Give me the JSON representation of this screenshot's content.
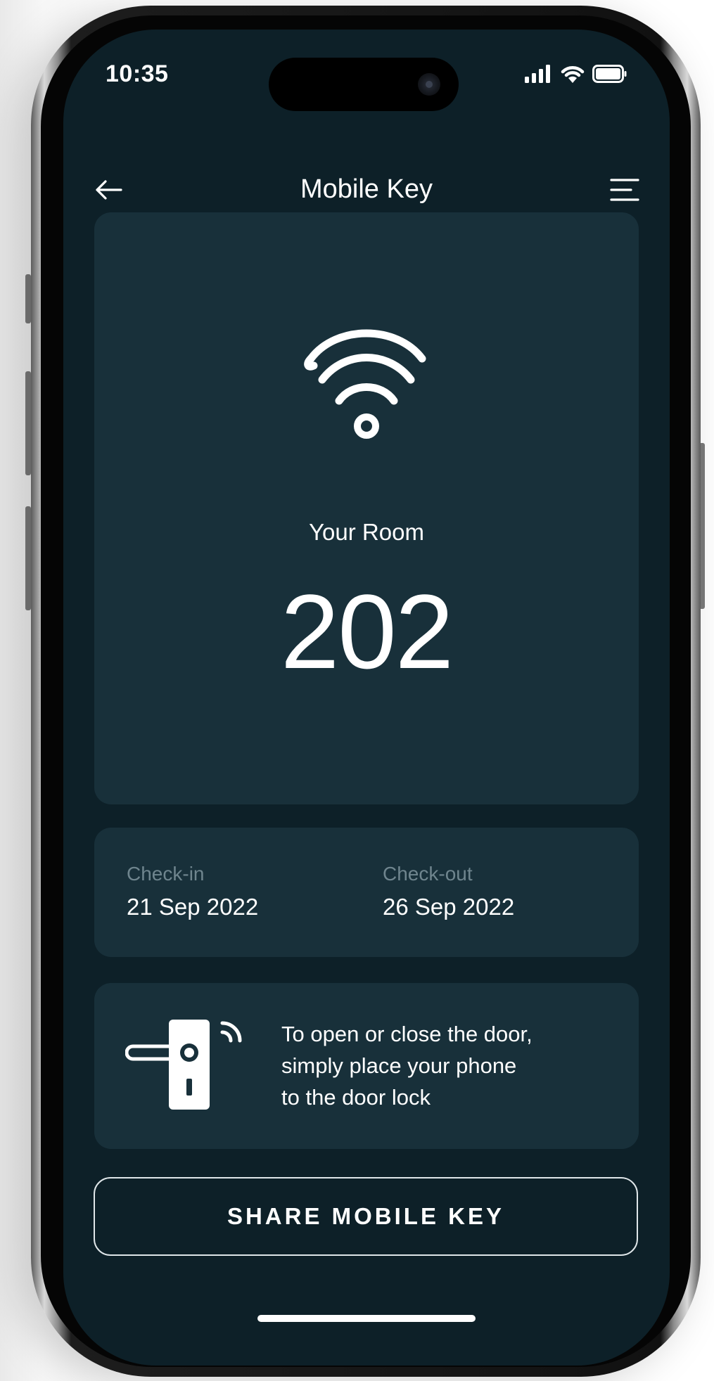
{
  "status_bar": {
    "time": "10:35",
    "icons": [
      "signal-icon",
      "wifi-icon",
      "battery-icon"
    ]
  },
  "header": {
    "title": "Mobile Key",
    "back_icon": "arrow-left-icon",
    "menu_icon": "menu-icon"
  },
  "room": {
    "icon": "wireless-signal-icon",
    "label": "Your Room",
    "number": "202"
  },
  "stay": {
    "checkin_label": "Check-in",
    "checkin_date": "21 Sep 2022",
    "checkout_label": "Check-out",
    "checkout_date": "26 Sep 2022"
  },
  "instructions": {
    "icon": "door-lock-icon",
    "text": "To open or close the door,\nsimply place your phone\nto the door lock"
  },
  "actions": {
    "share_label": "SHARE MOBILE KEY"
  },
  "colors": {
    "screen_bg": "#0d2028",
    "card_bg": "#18303a",
    "text_primary": "#ffffff",
    "text_muted": "#6f858e"
  }
}
